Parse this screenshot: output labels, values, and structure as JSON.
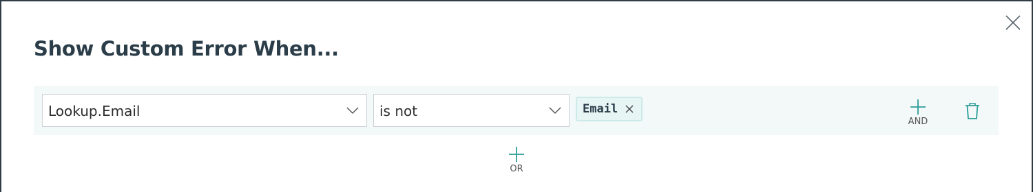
{
  "dialog": {
    "title": "Show Custom Error When...",
    "close_icon": "close-icon"
  },
  "condition": {
    "field": {
      "selected": "Lookup.Email",
      "icon": "chevron-down-icon"
    },
    "operator": {
      "selected": "is not",
      "icon": "chevron-down-icon"
    },
    "value_tag": {
      "label": "Email",
      "remove_icon": "close-icon"
    },
    "and_button": {
      "label": "AND",
      "icon": "plus-icon"
    },
    "delete_icon": "trash-icon"
  },
  "or_button": {
    "label": "OR",
    "icon": "plus-icon"
  },
  "colors": {
    "accent": "#2a9d98",
    "title": "#2b3d49",
    "row_background": "#f3f8f8",
    "tag_background": "#e8f5f5",
    "tag_border": "#cdeaea"
  }
}
